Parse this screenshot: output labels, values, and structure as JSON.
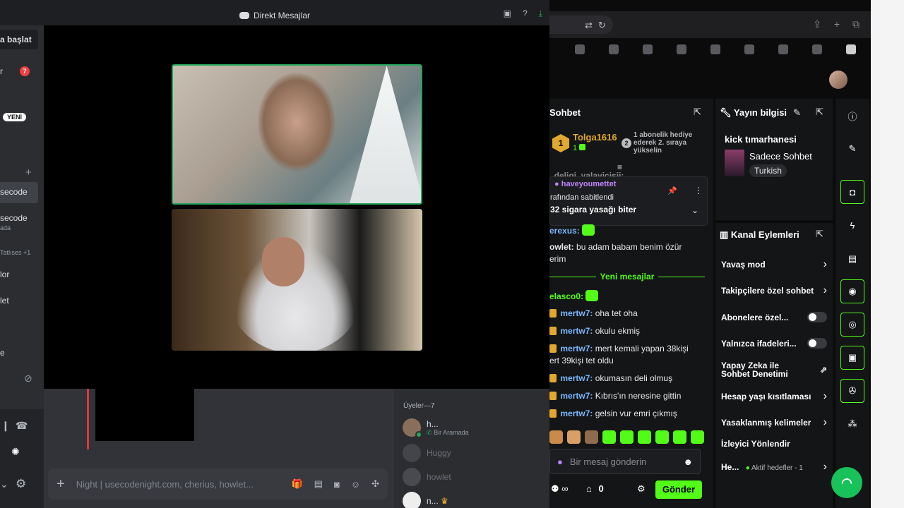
{
  "discord": {
    "title": "Direkt Mesajlar",
    "sidebar": {
      "start_label": "a başlat",
      "item_r": "r",
      "badge_count": "7",
      "new_badge": "YENİ",
      "plus": "+",
      "active_item": "secode",
      "item2": "secode",
      "item2_sub": "ada",
      "group_label": "Tatlıses +1",
      "item_lor": "lor",
      "item_let": "let",
      "item_e": "e"
    },
    "members": {
      "header": "Üyeler—7",
      "list": [
        {
          "name": "h...",
          "sub": "Bir Aramada"
        },
        {
          "name": "Huggy",
          "sub": ""
        },
        {
          "name": "howlet",
          "sub": ""
        },
        {
          "name": "n...",
          "sub": ""
        }
      ]
    },
    "composer_placeholder": "Night | usecodenight.com, cherius, howlet..."
  },
  "kick": {
    "chat_header": "Sohbet",
    "top_gifter": {
      "name": "Tolga1616",
      "rank": "1",
      "count": "1",
      "note_num": "2",
      "note": "1 abonelik hediye ederek 2. sıraya yükselin"
    },
    "partial_line": "_deligi_yalayicisii:",
    "pinned": {
      "user": "haveyoumettet",
      "by": "rafından sabitlendi",
      "text": "32 sigara yasağı biter"
    },
    "messages_before": [
      {
        "user": "erexus:",
        "text": ""
      },
      {
        "user": "owlet:",
        "text": "bu adam babam benim özür",
        "cont": "erim"
      }
    ],
    "new_messages_label": "Yeni mesajlar",
    "messages_after": [
      {
        "user": "elasco0:",
        "text": ""
      },
      {
        "user": "mertw7:",
        "text": "oha tet oha"
      },
      {
        "user": "mertw7:",
        "text": "okulu ekmiş"
      },
      {
        "user": "mertw7:",
        "text": "mert kemali yapan 38kişi",
        "cont": "ert 39kişi tet oldu"
      },
      {
        "user": "mertw7:",
        "text": "okumasın deli olmuş"
      },
      {
        "user": "mertw7:",
        "text": "Kıbrıs'ın neresine gittin"
      },
      {
        "user": "mertw7:",
        "text": "gelsin vur emri çıkmış"
      }
    ],
    "input_placeholder": "Bir mesaj gönderin",
    "infinity": "∞",
    "gift_count": "0",
    "send_label": "Gönder",
    "stream_info": {
      "header": "Yayın bilgisi",
      "title": "kick tımarhanesi",
      "category": "Sadece Sohbet",
      "language": "Turkish"
    },
    "channel_actions": {
      "header": "Kanal Eylemleri",
      "items": [
        "Yavaş mod",
        "Takipçilere özel sohbet",
        "Abonelere özel...",
        "Yalnızca ifadeleri...",
        "Yapay Zeka ile",
        "Sohbet Denetimi",
        "Hesap yaşı kısıtlaması",
        "Yasaklanmış kelimeler",
        "İzleyici Yönlendir",
        "He...",
        "Aktif hedefler - 1"
      ]
    }
  }
}
